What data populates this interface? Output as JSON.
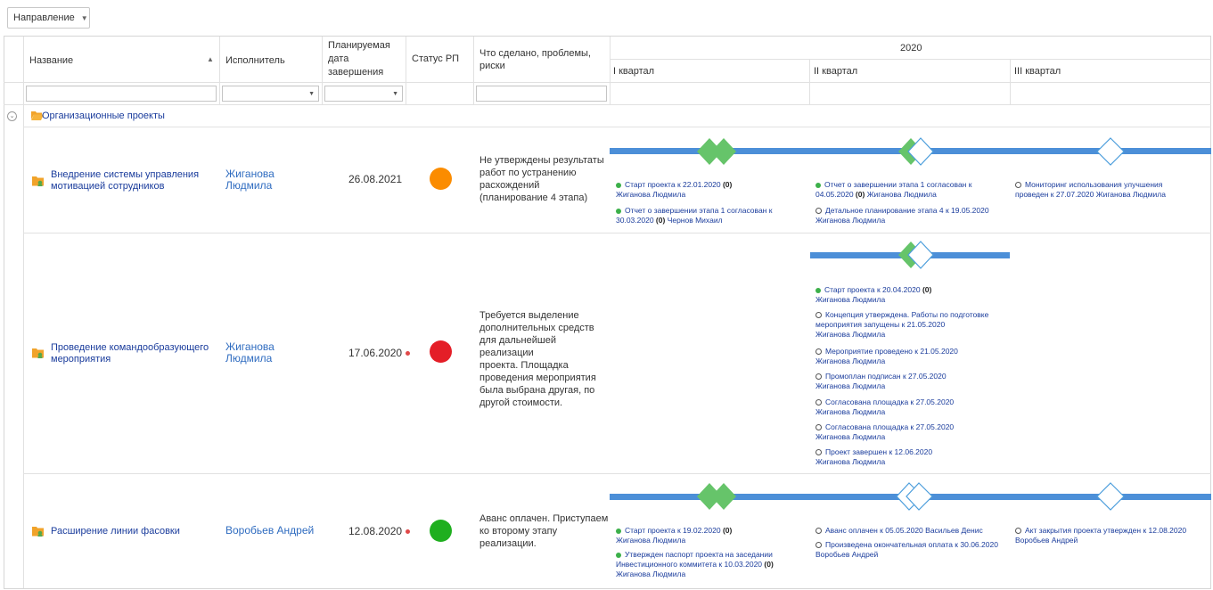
{
  "toolbar": {
    "direction_label": "Направление"
  },
  "header": {
    "name": "Название",
    "executor": "Исполнитель",
    "planned_date_l1": "Планируемая",
    "planned_date_l2": "дата",
    "planned_date_l3": "завершения",
    "status": "Статус РП",
    "notes_l1": "Что сделано, проблемы,",
    "notes_l2": "риски",
    "year": "2020",
    "q1": "I квартал",
    "q2": "II квартал",
    "q3": "III квартал"
  },
  "group": {
    "label": "Организационные проекты"
  },
  "colors": {
    "link": "#1a3c9c",
    "bar": "#4c8fd8",
    "milestone_done": "#66c46a",
    "orange": "#fb8c00",
    "red": "#e41e27",
    "green": "#1faf1f"
  },
  "projects": [
    {
      "name_l1": "Внедрение системы управления",
      "name_l2": "мотивацией сотрудников",
      "exec_l1": "Жиганова",
      "exec_l2": "Людмила",
      "date": "26.08.2021",
      "status_color": "orange",
      "notes": [
        "Не утверждены результаты",
        "работ по устранению",
        "расхождений",
        "(планирование 4 этапа)"
      ],
      "q1": [
        {
          "done": true,
          "l1": "Старт проекта к 22.01.2020",
          "cnt": "(0)",
          "l2": "Жиганова Людмила"
        },
        {
          "done": true,
          "l1": "Отчет о завершении этапа 1 согласован к",
          "l2": "30.03.2020",
          "cnt": "(0)",
          "l2b": "Чернов Михаил"
        }
      ],
      "q2": [
        {
          "done": true,
          "l1": "Отчет о завершении этапа 1 согласован к",
          "l2": "04.05.2020",
          "cnt": "(0)",
          "l2b": "Жиганова Людмила"
        },
        {
          "done": false,
          "l1": "Детальное планирование этапа 4 к 19.05.2020",
          "l2": "Жиганова Людмила"
        }
      ],
      "q3": [
        {
          "done": false,
          "l1": "Мониторинг использования улучшения",
          "l2": "проведен к 27.07.2020  Жиганова Людмила"
        }
      ]
    },
    {
      "name_l1": "Проведение командообразующего",
      "name_l2": "мероприятия",
      "exec_l1": "Жиганова",
      "exec_l2": "Людмила",
      "date": "17.06.2020",
      "status_color": "red",
      "notes": [
        "Требуется выделение",
        "дополнительных средств",
        "для дальнейшей реализации",
        "проекта. Площадка",
        "проведения мероприятия",
        "была выбрана другая, по",
        "другой стоимости."
      ],
      "q2": [
        {
          "done": true,
          "l1": "Старт проекта к 20.04.2020",
          "cnt": "(0)",
          "l2": "Жиганова Людмила"
        },
        {
          "done": false,
          "l1": "Концепция утверждена. Работы по подготовке",
          "l1b": "мероприятия запущены к 21.05.2020",
          "l2": "Жиганова Людмила"
        },
        {
          "done": false,
          "l1": "Мероприятие проведено к 21.05.2020",
          "l2": "Жиганова Людмила"
        },
        {
          "done": false,
          "l1": "Промоплан подписан к 27.05.2020",
          "l2": "Жиганова Людмила"
        },
        {
          "done": false,
          "l1": "Согласована площадка к 27.05.2020",
          "l2": "Жиганова Людмила"
        },
        {
          "done": false,
          "l1": "Согласована площадка к 27.05.2020",
          "l2": "Жиганова Людмила"
        },
        {
          "done": false,
          "l1": "Проект завершен к 12.06.2020",
          "l2": "Жиганова Людмила"
        }
      ]
    },
    {
      "name_l1": "Расширение линии фасовки",
      "exec_l1": "Воробьев Андрей",
      "date": "12.08.2020",
      "status_color": "green",
      "notes": [
        "Аванс оплачен. Приступаем",
        "ко второму этапу",
        "реализации."
      ],
      "q1": [
        {
          "done": true,
          "l1": "Старт проекта к 19.02.2020",
          "cnt": "(0)",
          "l2": "Жиганова Людмила"
        },
        {
          "done": true,
          "l1": "Утвержден паспорт проекта на заседании",
          "l1b": "Инвестиционного коммитета к 10.03.2020",
          "cnt": "(0)",
          "l2": "Жиганова Людмила"
        }
      ],
      "q2": [
        {
          "done": false,
          "l1": "Аванс оплачен к 05.05.2020  Васильев Денис"
        },
        {
          "done": false,
          "l1": "Произведена окончательная оплата к 30.06.2020",
          "l2": "Воробьев Андрей"
        }
      ],
      "q3": [
        {
          "done": false,
          "l1": "Акт закрытия проекта утвержден к 12.08.2020",
          "l2": "Воробьев Андрей"
        }
      ]
    }
  ]
}
